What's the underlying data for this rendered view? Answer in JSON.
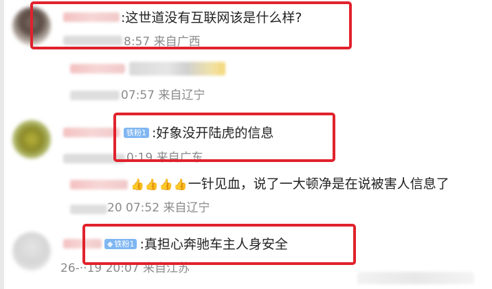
{
  "comments": [
    {
      "text": ":这世道没有互联网该是什么样?",
      "meta_time": "8:57",
      "meta_source": "来自广西",
      "badge": ""
    },
    {
      "text": "",
      "meta_time": "07:57",
      "meta_source": "来自辽宁",
      "badge": ""
    },
    {
      "text": ":好象没开陆虎的信息",
      "meta_time": "0:19",
      "meta_source": "来自广东",
      "badge": "铁粉1"
    },
    {
      "text": "一针见血，说了一大顿净是在说被害人信息了",
      "emoji": "👍👍👍👍",
      "meta_time": "20 07:52",
      "meta_source": "来自辽宁",
      "badge": ""
    },
    {
      "text": ":真担心奔驰车主人身安全",
      "meta_time": "26-··19 20:07",
      "meta_source": "来自江苏",
      "badge": "铁粉1"
    }
  ],
  "colors": {
    "highlight": "#e0222c",
    "badge": "#7fb6f2",
    "meta": "#8a8a8a"
  }
}
